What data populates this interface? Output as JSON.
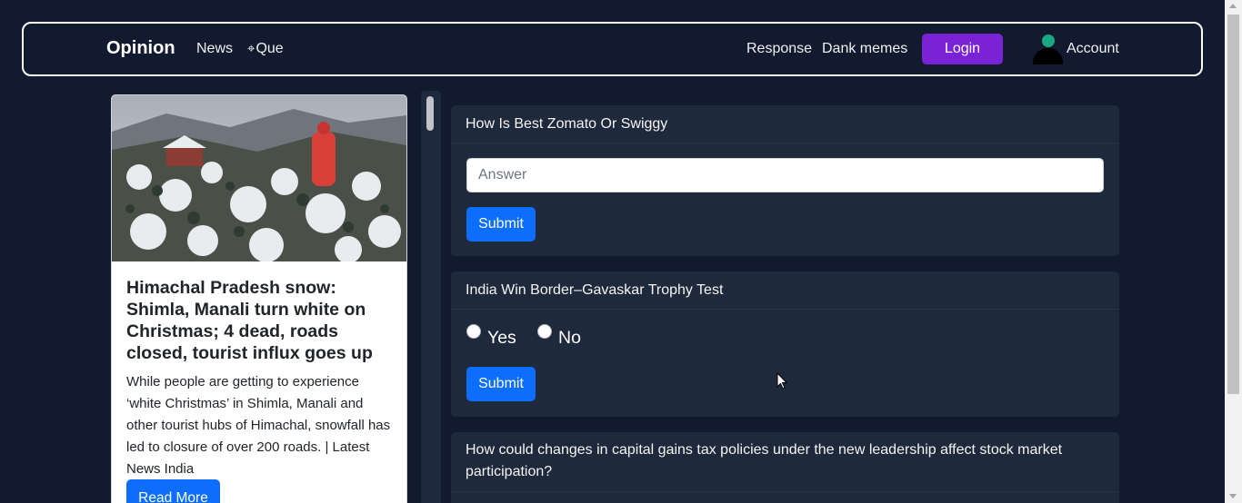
{
  "navbar": {
    "brand": "Opinion",
    "links": [
      {
        "label": "News",
        "icon": ""
      },
      {
        "label": "Que",
        "icon": "plus-diamond-icon"
      },
      {
        "label": "Response"
      },
      {
        "label": "Dank memes"
      }
    ],
    "login_label": "Login",
    "account_label": "Account",
    "que_icon_glyph": "⌖"
  },
  "news_card": {
    "title": "Himachal Pradesh snow: Shimla, Manali turn white on Christmas; 4 dead, roads closed, tourist influx goes up",
    "text": "While people are getting to experience ‘white Christmas’ in Shimla, Manali and other tourist hubs of Himachal, snowfall has led to closure of over 200 roads. | Latest News India",
    "read_more_label": "Read More"
  },
  "questions": [
    {
      "title": "How Is Best Zomato Or Swiggy",
      "answer_placeholder": "Answer",
      "submit_label": "Submit"
    },
    {
      "title": "India Win Border–Gavaskar Trophy Test",
      "options": [
        "Yes",
        "No"
      ],
      "submit_label": "Submit"
    },
    {
      "title": "How could changes in capital gains tax policies under the new leadership affect stock market participation?"
    }
  ],
  "colors": {
    "page_bg": "#111a2e",
    "card_bg": "#1e293b",
    "primary": "#0d6efd",
    "login_purple": "#7a22d6"
  }
}
